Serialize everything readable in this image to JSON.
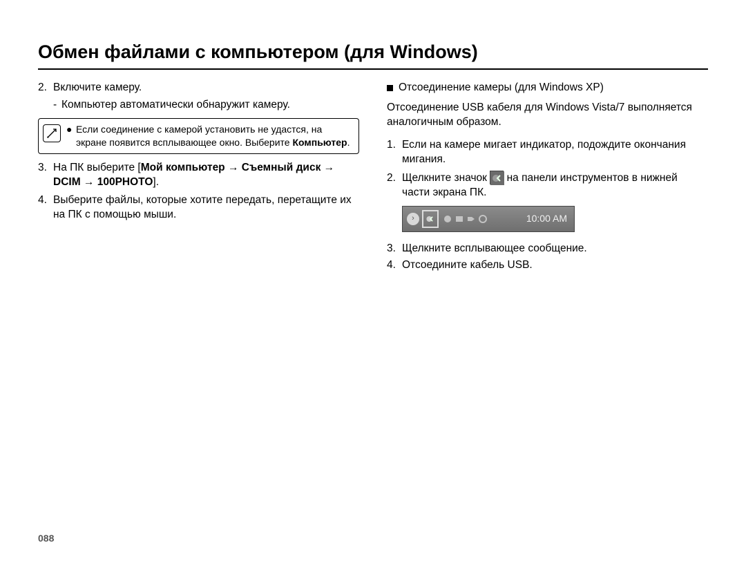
{
  "title": "Обмен файлами с компьютером (для Windows)",
  "left": {
    "step2_num": "2.",
    "step2_text": "Включите камеру.",
    "step2_sub": "Компьютер автоматически обнаружит камеру.",
    "note_line1": "Если соединение с камерой установить не удастся, на экране появится всплывающее окно. Выберите",
    "note_bold": "Компьютер",
    "note_period": ".",
    "step3_num": "3.",
    "step3_prefix": "На ПК выберите [",
    "step3_bold": "Мой компьютер → Съемный диск → DCIM → 100PHOTO",
    "step3_suffix": "].",
    "step4_num": "4.",
    "step4_text": "Выберите файлы, которые хотите передать, перетащите их на ПК с помощью мыши."
  },
  "right": {
    "subheading": "Отсоединение камеры (для Windows XP)",
    "para": "Отсоединение USB кабеля для Windows Vista/7 выполняется аналогичным образом.",
    "step1_num": "1.",
    "step1_text": "Если на камере мигает индикатор, подождите окончания мигания.",
    "step2_num": "2.",
    "step2_before": "Щелкните значок",
    "step2_after": "на панели инструментов в нижней части экрана ПК.",
    "taskbar_time": "10:00 AM",
    "step3_num": "3.",
    "step3_text": "Щелкните всплывающее сообщение.",
    "step4_num": "4.",
    "step4_text": "Отсоедините кабель USB."
  },
  "page_number": "088"
}
